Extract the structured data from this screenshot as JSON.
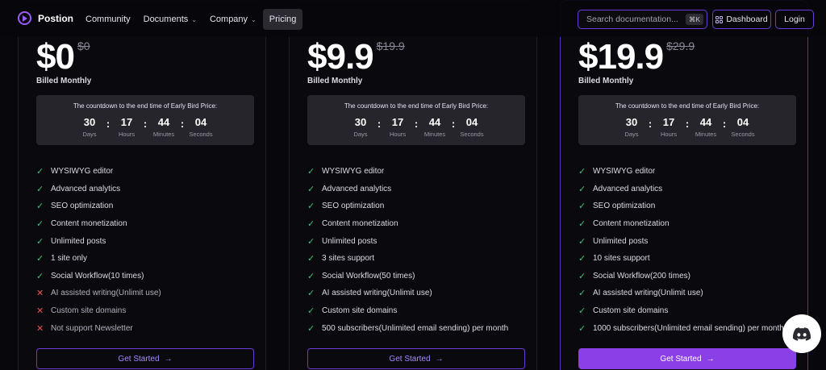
{
  "navbar": {
    "brand": "Postion",
    "links": [
      {
        "label": "Community",
        "dropdown": false,
        "active": false
      },
      {
        "label": "Documents",
        "dropdown": true,
        "active": false
      },
      {
        "label": "Company",
        "dropdown": true,
        "active": false
      },
      {
        "label": "Pricing",
        "dropdown": false,
        "active": true
      }
    ],
    "search_placeholder": "Search documentation...",
    "search_shortcut": "⌘K",
    "dashboard_label": "Dashboard",
    "login_label": "Login"
  },
  "countdown": {
    "title": "The countdown to the end time of Early Bird Price:",
    "units": [
      {
        "value": "30",
        "label": "Days"
      },
      {
        "value": "17",
        "label": "Hours"
      },
      {
        "value": "44",
        "label": "Minutes"
      },
      {
        "value": "04",
        "label": "Seconds"
      }
    ]
  },
  "plans": [
    {
      "price": "$0",
      "old_price": "$0",
      "billed": "Billed Monthly",
      "cta": "Get Started",
      "featured": false,
      "features": [
        {
          "text": "WYSIWYG editor",
          "included": true
        },
        {
          "text": "Advanced analytics",
          "included": true
        },
        {
          "text": "SEO optimization",
          "included": true
        },
        {
          "text": "Content monetization",
          "included": true
        },
        {
          "text": "Unlimited posts",
          "included": true
        },
        {
          "text": "1 site only",
          "included": true
        },
        {
          "text": "Social Workflow(10 times)",
          "included": true
        },
        {
          "text": "AI assisted writing(Unlimit use)",
          "included": false
        },
        {
          "text": "Custom site domains",
          "included": false
        },
        {
          "text": "Not support Newsletter",
          "included": false
        }
      ]
    },
    {
      "price": "$9.9",
      "old_price": "$19.9",
      "billed": "Billed Monthly",
      "cta": "Get Started",
      "featured": false,
      "features": [
        {
          "text": "WYSIWYG editor",
          "included": true
        },
        {
          "text": "Advanced analytics",
          "included": true
        },
        {
          "text": "SEO optimization",
          "included": true
        },
        {
          "text": "Content monetization",
          "included": true
        },
        {
          "text": "Unlimited posts",
          "included": true
        },
        {
          "text": "3 sites support",
          "included": true
        },
        {
          "text": "Social Workflow(50 times)",
          "included": true
        },
        {
          "text": "AI assisted writing(Unlimit use)",
          "included": true
        },
        {
          "text": "Custom site domains",
          "included": true
        },
        {
          "text": "500 subscribers(Unlimited email sending) per month",
          "included": true
        }
      ]
    },
    {
      "price": "$19.9",
      "old_price": "$29.9",
      "billed": "Billed Monthly",
      "cta": "Get Started",
      "featured": true,
      "features": [
        {
          "text": "WYSIWYG editor",
          "included": true
        },
        {
          "text": "Advanced analytics",
          "included": true
        },
        {
          "text": "SEO optimization",
          "included": true
        },
        {
          "text": "Content monetization",
          "included": true
        },
        {
          "text": "Unlimited posts",
          "included": true
        },
        {
          "text": "10 sites support",
          "included": true
        },
        {
          "text": "Social Workflow(200 times)",
          "included": true
        },
        {
          "text": "AI assisted writing(Unlimit use)",
          "included": true
        },
        {
          "text": "Custom site domains",
          "included": true
        },
        {
          "text": "1000 subscribers(Unlimited email sending) per month",
          "included": true
        }
      ]
    }
  ],
  "icons": {
    "brand": "play-circle-icon",
    "check": "check-icon",
    "cross": "cross-icon",
    "arrow": "arrow-right-icon",
    "dashboard": "grid-icon",
    "fab": "discord-icon"
  },
  "colors": {
    "accent": "#8b3fe6",
    "accent_border": "#6c3ad6",
    "check": "#3cc27a",
    "cross": "#e5564f",
    "background": "#08070b"
  }
}
